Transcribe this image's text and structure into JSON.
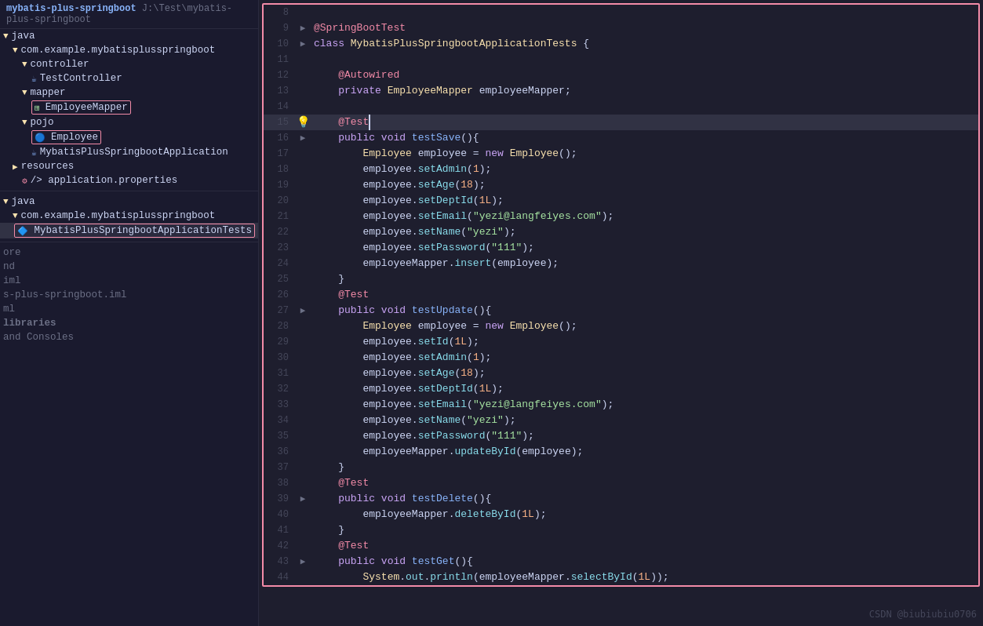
{
  "app": {
    "title": "mybatis-plus-springboot",
    "path": "J:\\Test\\mybatis-plus-springboot"
  },
  "sidebar": {
    "header": "mybatis-plus-springboot J:\\Test\\mybatis-plus-springboot",
    "tree": [
      {
        "id": "java-root",
        "label": "java",
        "indent": 0,
        "type": "folder",
        "expanded": true
      },
      {
        "id": "com-pkg",
        "label": "com.example.mybatisplusspringboot",
        "indent": 1,
        "type": "package",
        "expanded": true
      },
      {
        "id": "controller",
        "label": "controller",
        "indent": 2,
        "type": "folder",
        "expanded": true
      },
      {
        "id": "TestController",
        "label": "TestController",
        "indent": 3,
        "type": "java",
        "highlighted": false
      },
      {
        "id": "mapper",
        "label": "mapper",
        "indent": 2,
        "type": "folder",
        "expanded": true
      },
      {
        "id": "EmployeeMapper",
        "label": "EmployeeMapper",
        "indent": 3,
        "type": "mapper",
        "highlighted": true
      },
      {
        "id": "pojo",
        "label": "pojo",
        "indent": 2,
        "type": "folder",
        "expanded": true
      },
      {
        "id": "Employee",
        "label": "Employee",
        "indent": 3,
        "type": "entity",
        "highlighted": true
      },
      {
        "id": "MybatisPlusSpringbootApplication",
        "label": "MybatisPlusSpringbootApplication",
        "indent": 3,
        "type": "java",
        "highlighted": false
      },
      {
        "id": "resources",
        "label": "resources",
        "indent": 1,
        "type": "folder",
        "expanded": false
      },
      {
        "id": "application-properties",
        "label": "application.properties",
        "indent": 2,
        "type": "resource",
        "highlighted": false
      }
    ],
    "test_tree": [
      {
        "id": "java-test",
        "label": "java",
        "indent": 0,
        "type": "folder",
        "expanded": true
      },
      {
        "id": "com-pkg-test",
        "label": "com.example.mybatisplusspringboot",
        "indent": 1,
        "type": "package",
        "expanded": true
      },
      {
        "id": "MybatisPlusSpringbootApplicationTests",
        "label": "MybatisPlusSpringbootApplicationTests",
        "indent": 2,
        "type": "test",
        "highlighted": true
      }
    ],
    "bottom_items": [
      {
        "id": "ore",
        "label": "ore"
      },
      {
        "id": "nd",
        "label": "nd"
      },
      {
        "id": "iml",
        "label": "iml"
      },
      {
        "id": "mybatis-iml",
        "label": "s-plus-springboot.iml"
      },
      {
        "id": "ml",
        "label": "ml"
      },
      {
        "id": "libraries",
        "label": "libraries"
      },
      {
        "id": "and-consoles",
        "label": "and Consoles"
      }
    ]
  },
  "editor": {
    "lines": [
      {
        "num": 8,
        "gutter": "",
        "code": ""
      },
      {
        "num": 9,
        "gutter": "▶",
        "code": "@SpringBootTest",
        "type": "annotation"
      },
      {
        "num": 10,
        "gutter": "▶",
        "code": "class MybatisPlusSpringbootApplicationTests {",
        "type": "class"
      },
      {
        "num": 11,
        "gutter": "",
        "code": ""
      },
      {
        "num": 12,
        "gutter": "",
        "code": "    @Autowired",
        "type": "annotation"
      },
      {
        "num": 13,
        "gutter": "",
        "code": "    private EmployeeMapper employeeMapper;",
        "type": "plain"
      },
      {
        "num": 14,
        "gutter": "",
        "code": ""
      },
      {
        "num": 15,
        "gutter": "",
        "code": "    @Test",
        "type": "annotation",
        "cursor": true,
        "bulb": true
      },
      {
        "num": 16,
        "gutter": "▶",
        "code": "    public void testSave(){",
        "type": "method"
      },
      {
        "num": 17,
        "gutter": "",
        "code": "        Employee employee = new Employee();",
        "type": "plain"
      },
      {
        "num": 18,
        "gutter": "",
        "code": "        employee.setAdmin(1);",
        "type": "plain"
      },
      {
        "num": 19,
        "gutter": "",
        "code": "        employee.setAge(18);",
        "type": "plain"
      },
      {
        "num": 20,
        "gutter": "",
        "code": "        employee.setDeptId(1L);",
        "type": "plain"
      },
      {
        "num": 21,
        "gutter": "",
        "code": "        employee.setEmail(\"yezi@langfeiyes.com\");",
        "type": "plain"
      },
      {
        "num": 22,
        "gutter": "",
        "code": "        employee.setName(\"yezi\");",
        "type": "plain"
      },
      {
        "num": 23,
        "gutter": "",
        "code": "        employee.setPassword(\"111\");",
        "type": "plain"
      },
      {
        "num": 24,
        "gutter": "",
        "code": "        employeeMapper.insert(employee);",
        "type": "plain"
      },
      {
        "num": 25,
        "gutter": "",
        "code": "    }",
        "type": "plain"
      },
      {
        "num": 26,
        "gutter": "",
        "code": "    @Test",
        "type": "annotation"
      },
      {
        "num": 27,
        "gutter": "▶",
        "code": "    public void testUpdate(){",
        "type": "method"
      },
      {
        "num": 28,
        "gutter": "",
        "code": "        Employee employee = new Employee();",
        "type": "plain"
      },
      {
        "num": 29,
        "gutter": "",
        "code": "        employee.setId(1L);",
        "type": "plain"
      },
      {
        "num": 30,
        "gutter": "",
        "code": "        employee.setAdmin(1);",
        "type": "plain"
      },
      {
        "num": 31,
        "gutter": "",
        "code": "        employee.setAge(18);",
        "type": "plain"
      },
      {
        "num": 32,
        "gutter": "",
        "code": "        employee.setDeptId(1L);",
        "type": "plain"
      },
      {
        "num": 33,
        "gutter": "",
        "code": "        employee.setEmail(\"yezi@langfeiyes.com\");",
        "type": "plain"
      },
      {
        "num": 34,
        "gutter": "",
        "code": "        employee.setName(\"yezi\");",
        "type": "plain"
      },
      {
        "num": 35,
        "gutter": "",
        "code": "        employee.setPassword(\"111\");",
        "type": "plain"
      },
      {
        "num": 36,
        "gutter": "",
        "code": "        employeeMapper.updateById(employee);",
        "type": "plain"
      },
      {
        "num": 37,
        "gutter": "",
        "code": "    }",
        "type": "plain"
      },
      {
        "num": 38,
        "gutter": "",
        "code": "    @Test",
        "type": "annotation"
      },
      {
        "num": 39,
        "gutter": "▶",
        "code": "    public void testDelete(){",
        "type": "method"
      },
      {
        "num": 40,
        "gutter": "",
        "code": "        employeeMapper.deleteById(1L);",
        "type": "plain"
      },
      {
        "num": 41,
        "gutter": "",
        "code": "    }",
        "type": "plain"
      },
      {
        "num": 42,
        "gutter": "",
        "code": "    @Test",
        "type": "annotation"
      },
      {
        "num": 43,
        "gutter": "▶",
        "code": "    public void testGet(){",
        "type": "method"
      },
      {
        "num": 44,
        "gutter": "",
        "code": "        System.out.println(employeeMapper.selectById(1L));",
        "type": "plain"
      }
    ]
  },
  "watermark": "CSDN @biubiubiu0706"
}
